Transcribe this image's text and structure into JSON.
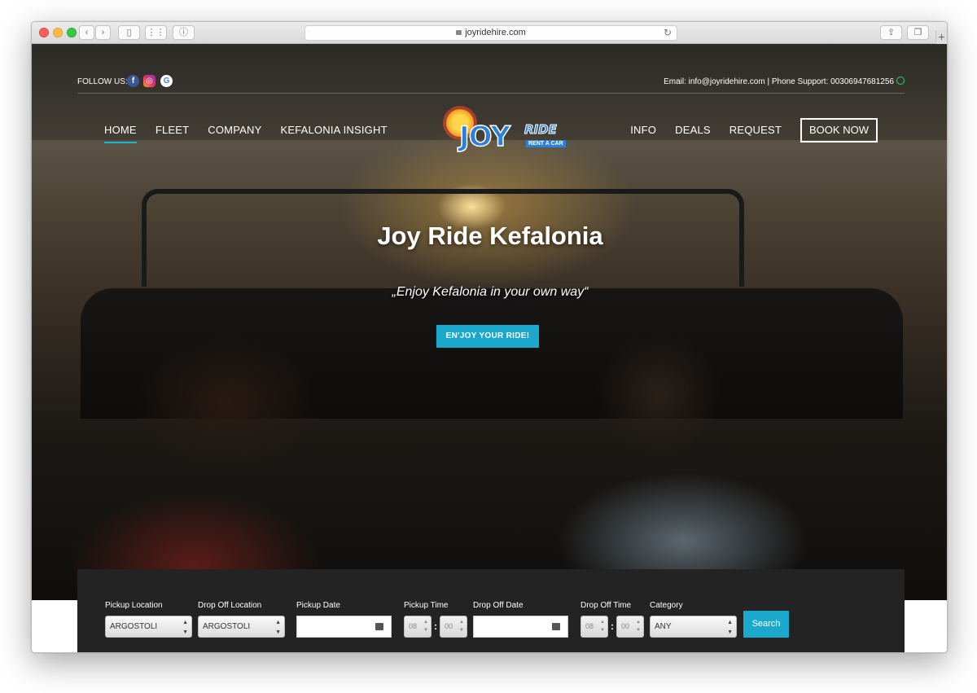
{
  "browser": {
    "url": "joyridehire.com"
  },
  "header": {
    "follow_label": "FOLLOW US:",
    "contact_text": "Email: info@joyridehire.com  | Phone Support: 00306947681256",
    "nav_left": [
      "HOME",
      "FLEET",
      "COMPANY",
      "KEFALONIA INSIGHT"
    ],
    "nav_right": [
      "INFO",
      "DEALS",
      "REQUEST"
    ],
    "book_now": "BOOK NOW",
    "logo": {
      "main": "JOY",
      "sub": "RIDE",
      "tag": "RENT A CAR"
    }
  },
  "hero": {
    "title": "Joy Ride Kefalonia",
    "subtitle": "„Enjoy Kefalonia in your own way“",
    "cta": "EN'JOY YOUR RIDE!"
  },
  "search": {
    "pickup_location_label": "Pickup Location",
    "pickup_location_value": "ARGOSTOLI",
    "dropoff_location_label": "Drop Off Location",
    "dropoff_location_value": "ARGOSTOLI",
    "pickup_date_label": "Pickup Date",
    "pickup_time_label": "Pickup Time",
    "pickup_hour": "08",
    "pickup_min": "00",
    "dropoff_date_label": "Drop Off Date",
    "dropoff_time_label": "Drop Off Time",
    "dropoff_hour": "08",
    "dropoff_min": "00",
    "category_label": "Category",
    "category_value": "ANY",
    "button": "Search"
  },
  "colors": {
    "accent": "#1aa9cd",
    "panel": "#232323"
  }
}
